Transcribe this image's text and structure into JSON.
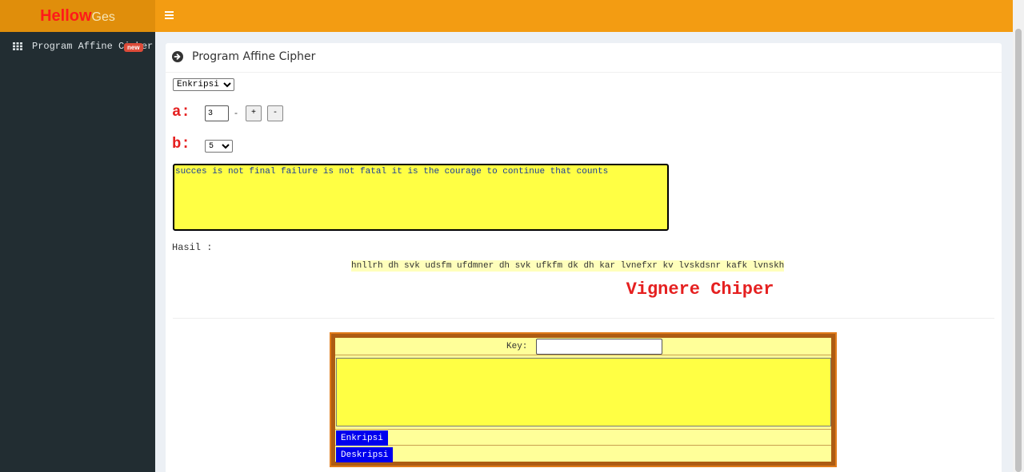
{
  "brand": {
    "part1": "Hellow",
    "part2": "Ges"
  },
  "sidebar": {
    "items": [
      {
        "label": "Program Affine Cipher",
        "badge": "new",
        "icon": "grid-icon"
      }
    ]
  },
  "box": {
    "title": "Program Affine Cipher",
    "icon": "circle-arrow-right-icon"
  },
  "affine": {
    "mode_selected": "Enkripsi",
    "a_label": "a:",
    "a_value": "3",
    "a_separator": "-",
    "plus_label": "+",
    "minus_label": "-",
    "b_label": "b:",
    "b_selected": "5",
    "plaintext": "succes is not final failure is not fatal it is the courage to continue that counts",
    "result_label": "Hasil :",
    "result_value": "hnllrh dh svk udsfm ufdmner dh svk ufkfm dk dh kar lvnefxr kv lvskdsnr kafk lvnskh"
  },
  "vigenere": {
    "title": "Vignere Chiper",
    "key_label": "Key:",
    "key_value": "",
    "text_value": "",
    "encrypt_label": "Enkripsi",
    "decrypt_label": "Deskripsi"
  },
  "colors": {
    "topbar": "#f39c12",
    "brand_bg": "#e08e0b",
    "sidebar": "#222d32",
    "accent_red": "#e52020",
    "textarea_yellow": "#ffff44",
    "button_blue": "#0000ee"
  }
}
